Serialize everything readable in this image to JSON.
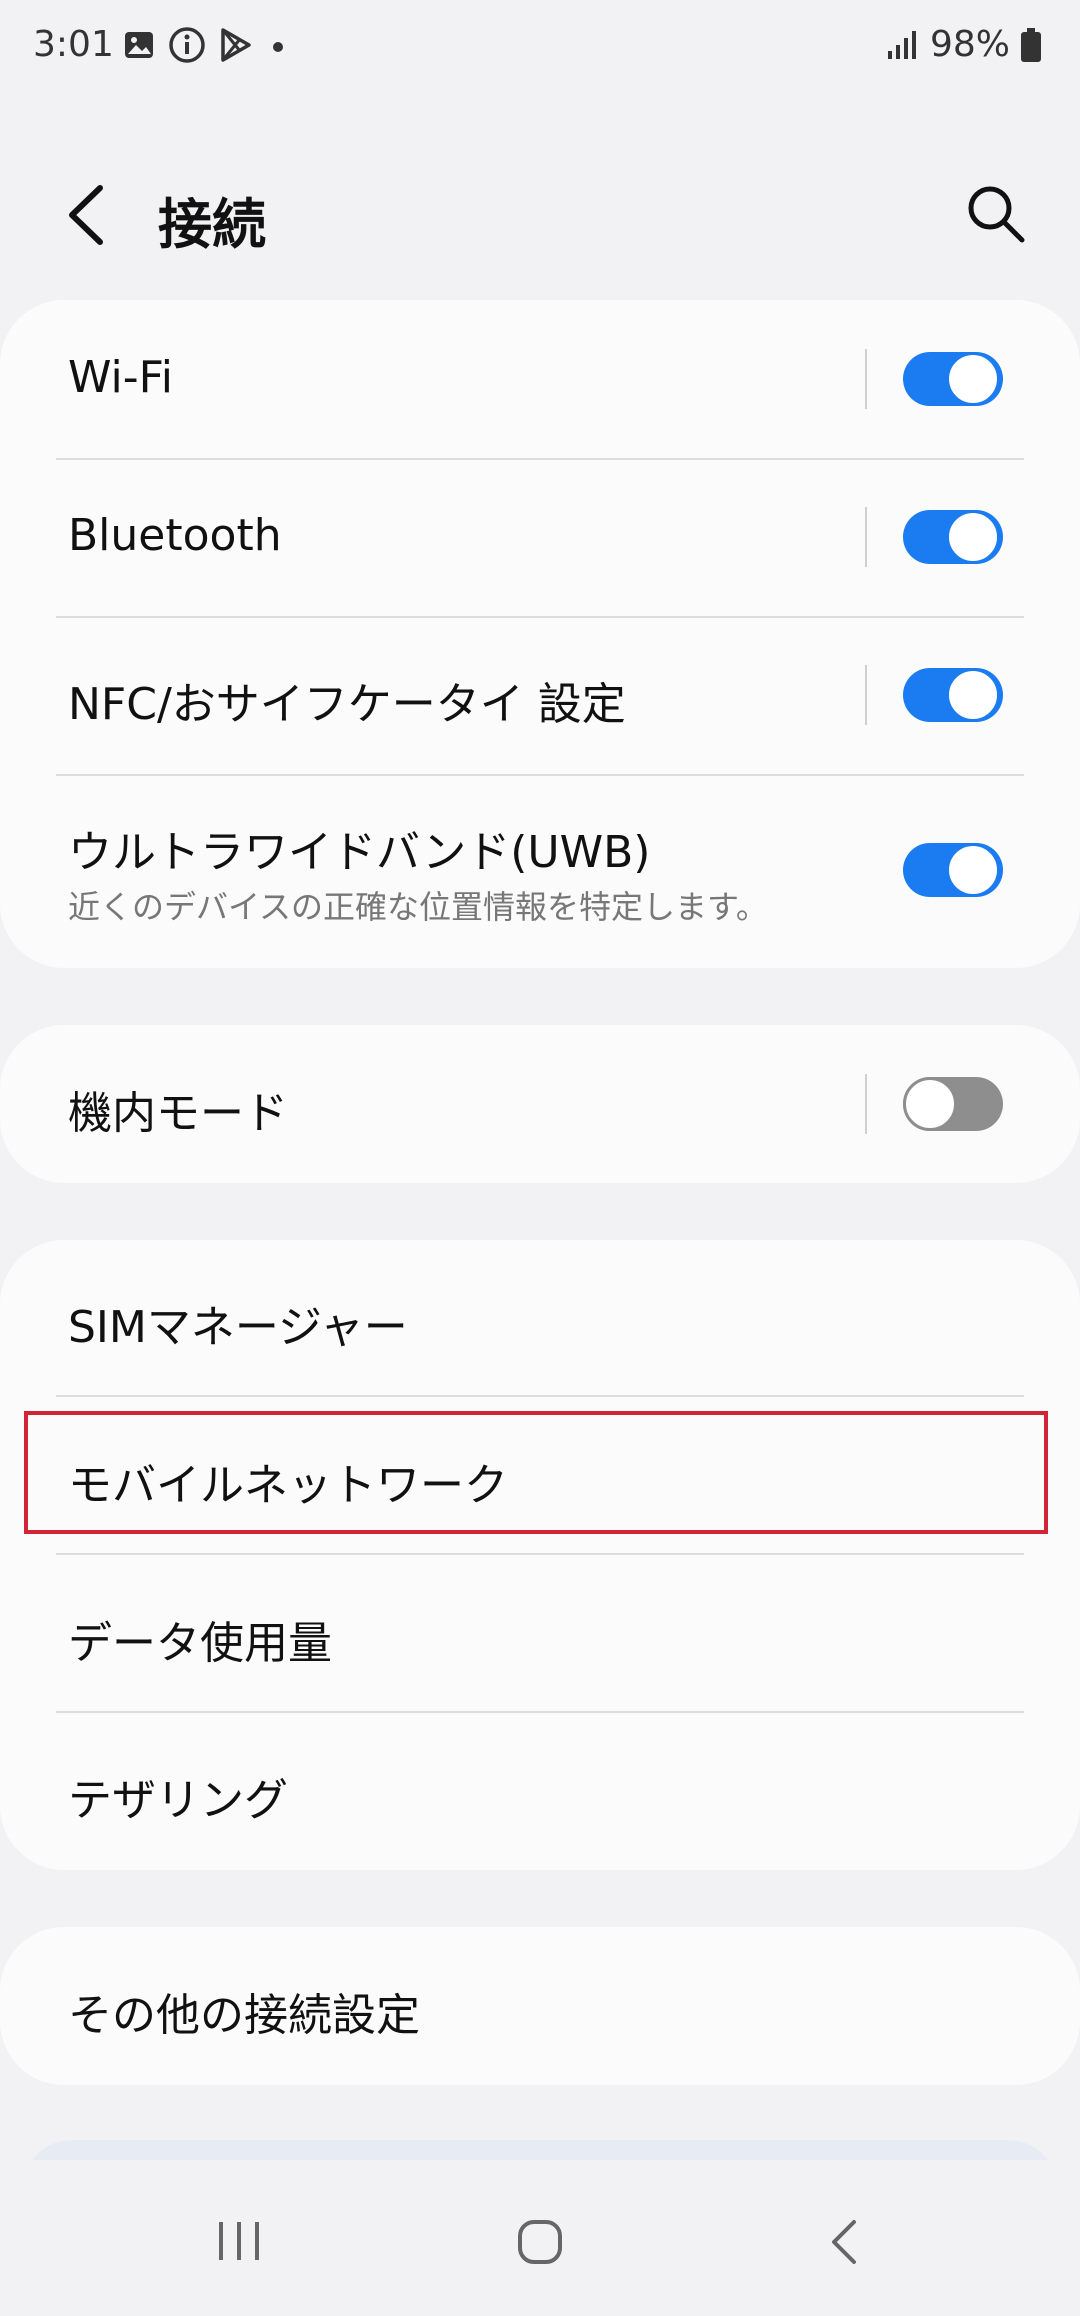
{
  "status_bar": {
    "time": "3:01",
    "battery": "98%",
    "icons": [
      "gallery-icon",
      "info-icon",
      "play-store-icon",
      "dot-icon",
      "signal-icon",
      "battery-icon"
    ]
  },
  "header": {
    "title": "接続",
    "icons": [
      "back-icon",
      "search-icon"
    ]
  },
  "sections": {
    "wireless": [
      {
        "label": "Wi-Fi",
        "toggle": true
      },
      {
        "label": "Bluetooth",
        "toggle": true
      },
      {
        "label": "NFC/おサイフケータイ 設定",
        "toggle": true
      },
      {
        "label": "ウルトラワイドバンド(UWB)",
        "sub": "近くのデバイスの正確な位置情報を特定します。",
        "toggle": true
      }
    ],
    "airplane": [
      {
        "label": "機内モード",
        "toggle": false
      }
    ],
    "network": [
      {
        "label": "SIMマネージャー"
      },
      {
        "label": "モバイルネットワーク"
      },
      {
        "label": "データ使用量"
      },
      {
        "label": "テザリング"
      }
    ],
    "more": [
      {
        "label": "その他の接続設定"
      }
    ]
  },
  "colors": {
    "accent": "#1a7cf0",
    "highlight": "#d12436",
    "toggle_off": "#8e8e8e"
  },
  "nav": {
    "icons": [
      "recent-apps-icon",
      "home-icon",
      "back-nav-icon"
    ]
  }
}
